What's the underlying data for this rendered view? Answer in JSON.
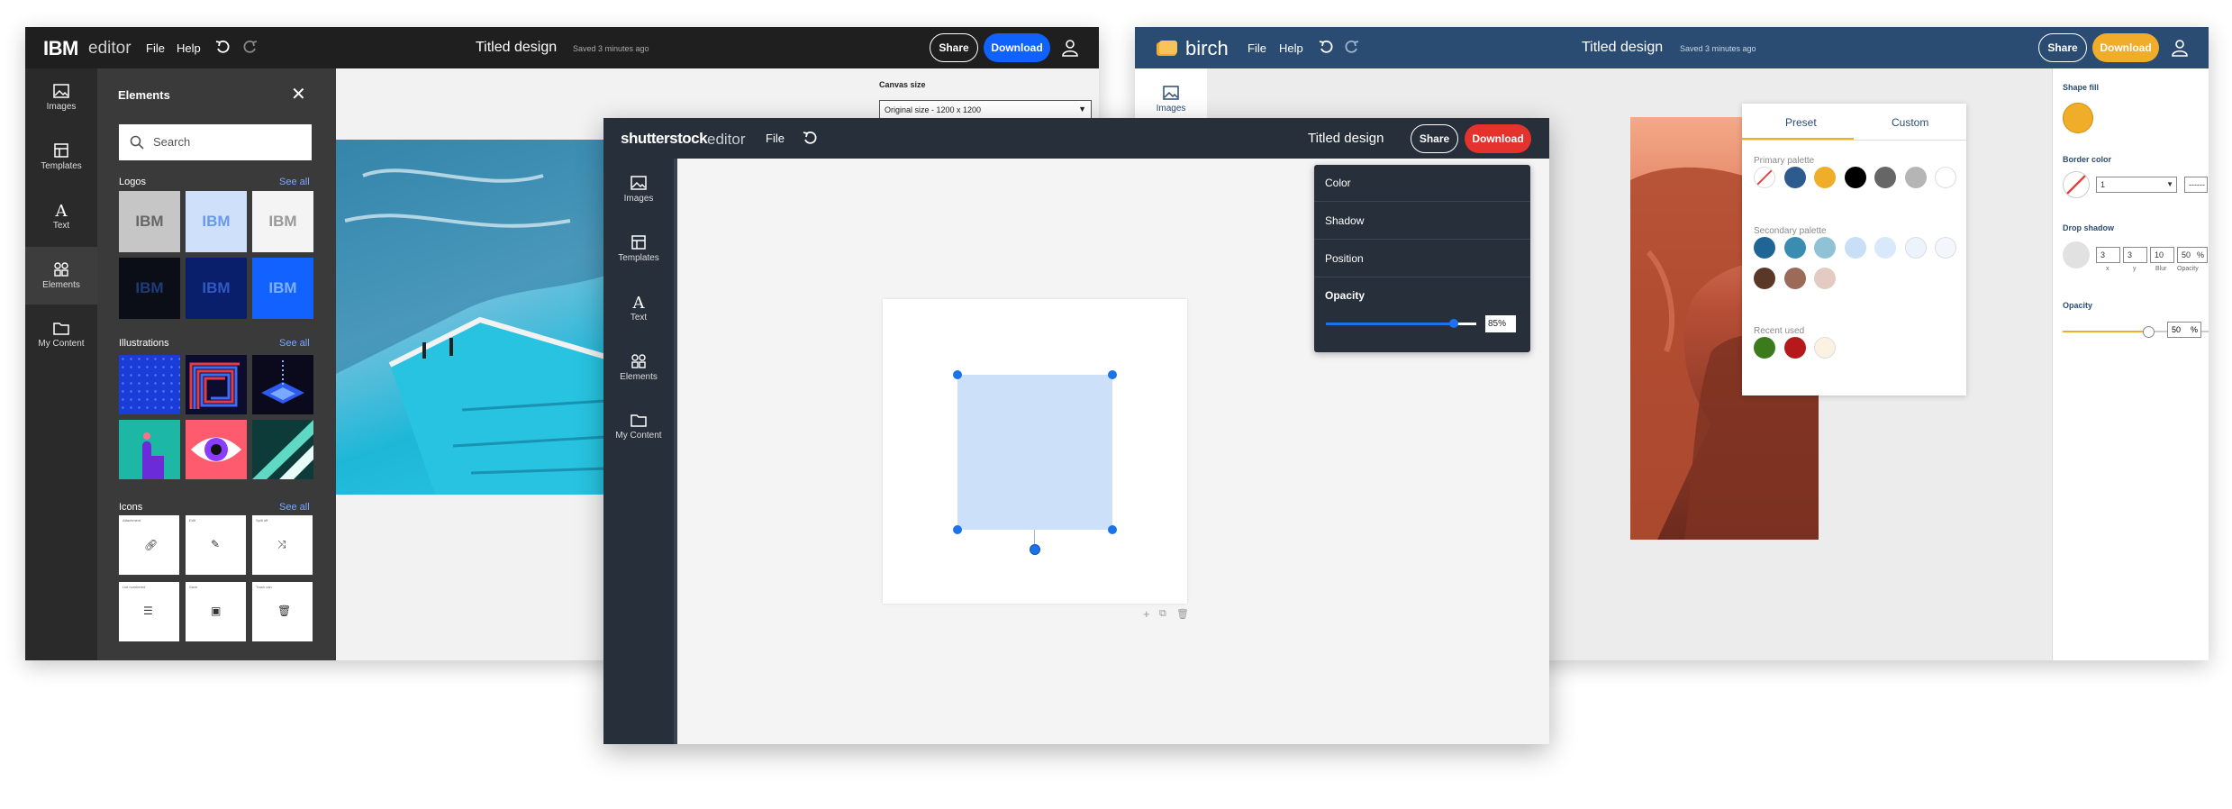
{
  "ibm": {
    "logo": "IBM",
    "logo_suffix": "editor",
    "menu": [
      "File",
      "Help"
    ],
    "title": "Titled design",
    "saved": "Saved 3 minutes ago",
    "share": "Share",
    "download": "Download",
    "rail": [
      "Images",
      "Templates",
      "Text",
      "Elements",
      "My Content"
    ],
    "panel_title": "Elements",
    "search_placeholder": "Search",
    "logos_label": "Logos",
    "illustrations_label": "Illustrations",
    "icons_label": "Icons",
    "see_all": "See all",
    "logo_tile_text": "IBM",
    "icon_tiles": [
      "Attachment",
      "Edit",
      "Split off",
      "List numbered",
      "Save",
      "Trash can"
    ],
    "canvas_size_label": "Canvas size",
    "canvas_size_value": "Original size - 1200 x 1200"
  },
  "birch": {
    "logo": "birch",
    "menu": [
      "File",
      "Help"
    ],
    "title": "Titled design",
    "saved": "Saved 3 minutes ago",
    "share": "Share",
    "download": "Download",
    "rail": [
      "Images"
    ],
    "popover": {
      "tabs": [
        "Preset",
        "Custom"
      ],
      "primary_label": "Primary palette",
      "secondary_label": "Secondary palette",
      "recent_label": "Recent used",
      "primary": [
        "none",
        "#2d5b8e",
        "#f0ad2a",
        "#000000",
        "#666666",
        "#b5b5b5",
        "#ffffff"
      ],
      "secondary": [
        "#1f6596",
        "#3a8db0",
        "#8fc2d4",
        "#c9dff5",
        "#d9e8fb",
        "#edf3fd",
        "#f3f6fa",
        "#5b3728",
        "#9c6a58",
        "#e3cbc3"
      ],
      "recent": [
        "#3c7a1e",
        "#b5191c",
        "#fbf2e2"
      ]
    },
    "props": {
      "shape_fill_label": "Shape fill",
      "shape_fill_color": "#f0ad2a",
      "border_color_label": "Border color",
      "border_width": "1",
      "border_style": "-------------",
      "drop_shadow_label": "Drop shadow",
      "shadow_values": [
        "3",
        "3",
        "10",
        "50"
      ],
      "shadow_units": [
        "",
        "",
        "",
        "%"
      ],
      "shadow_captions": [
        "x",
        "y",
        "Blur",
        "Opacity"
      ],
      "opacity_label": "Opacity",
      "opacity_value": "50",
      "opacity_unit": "%",
      "opacity_level": 0.5
    }
  },
  "shutterstock": {
    "logo": "shutterstock",
    "logo_suffix": "editor",
    "menu": [
      "File"
    ],
    "title": "Titled design",
    "share": "Share",
    "download": "Download",
    "rail": [
      "Images",
      "Templates",
      "Text",
      "Elements",
      "My Content"
    ],
    "menu_panel": [
      "Color",
      "Shadow",
      "Position"
    ],
    "opacity_label": "Opacity",
    "opacity_value": "85%",
    "opacity_level": 0.85,
    "shape_color": "#cce1f9"
  }
}
